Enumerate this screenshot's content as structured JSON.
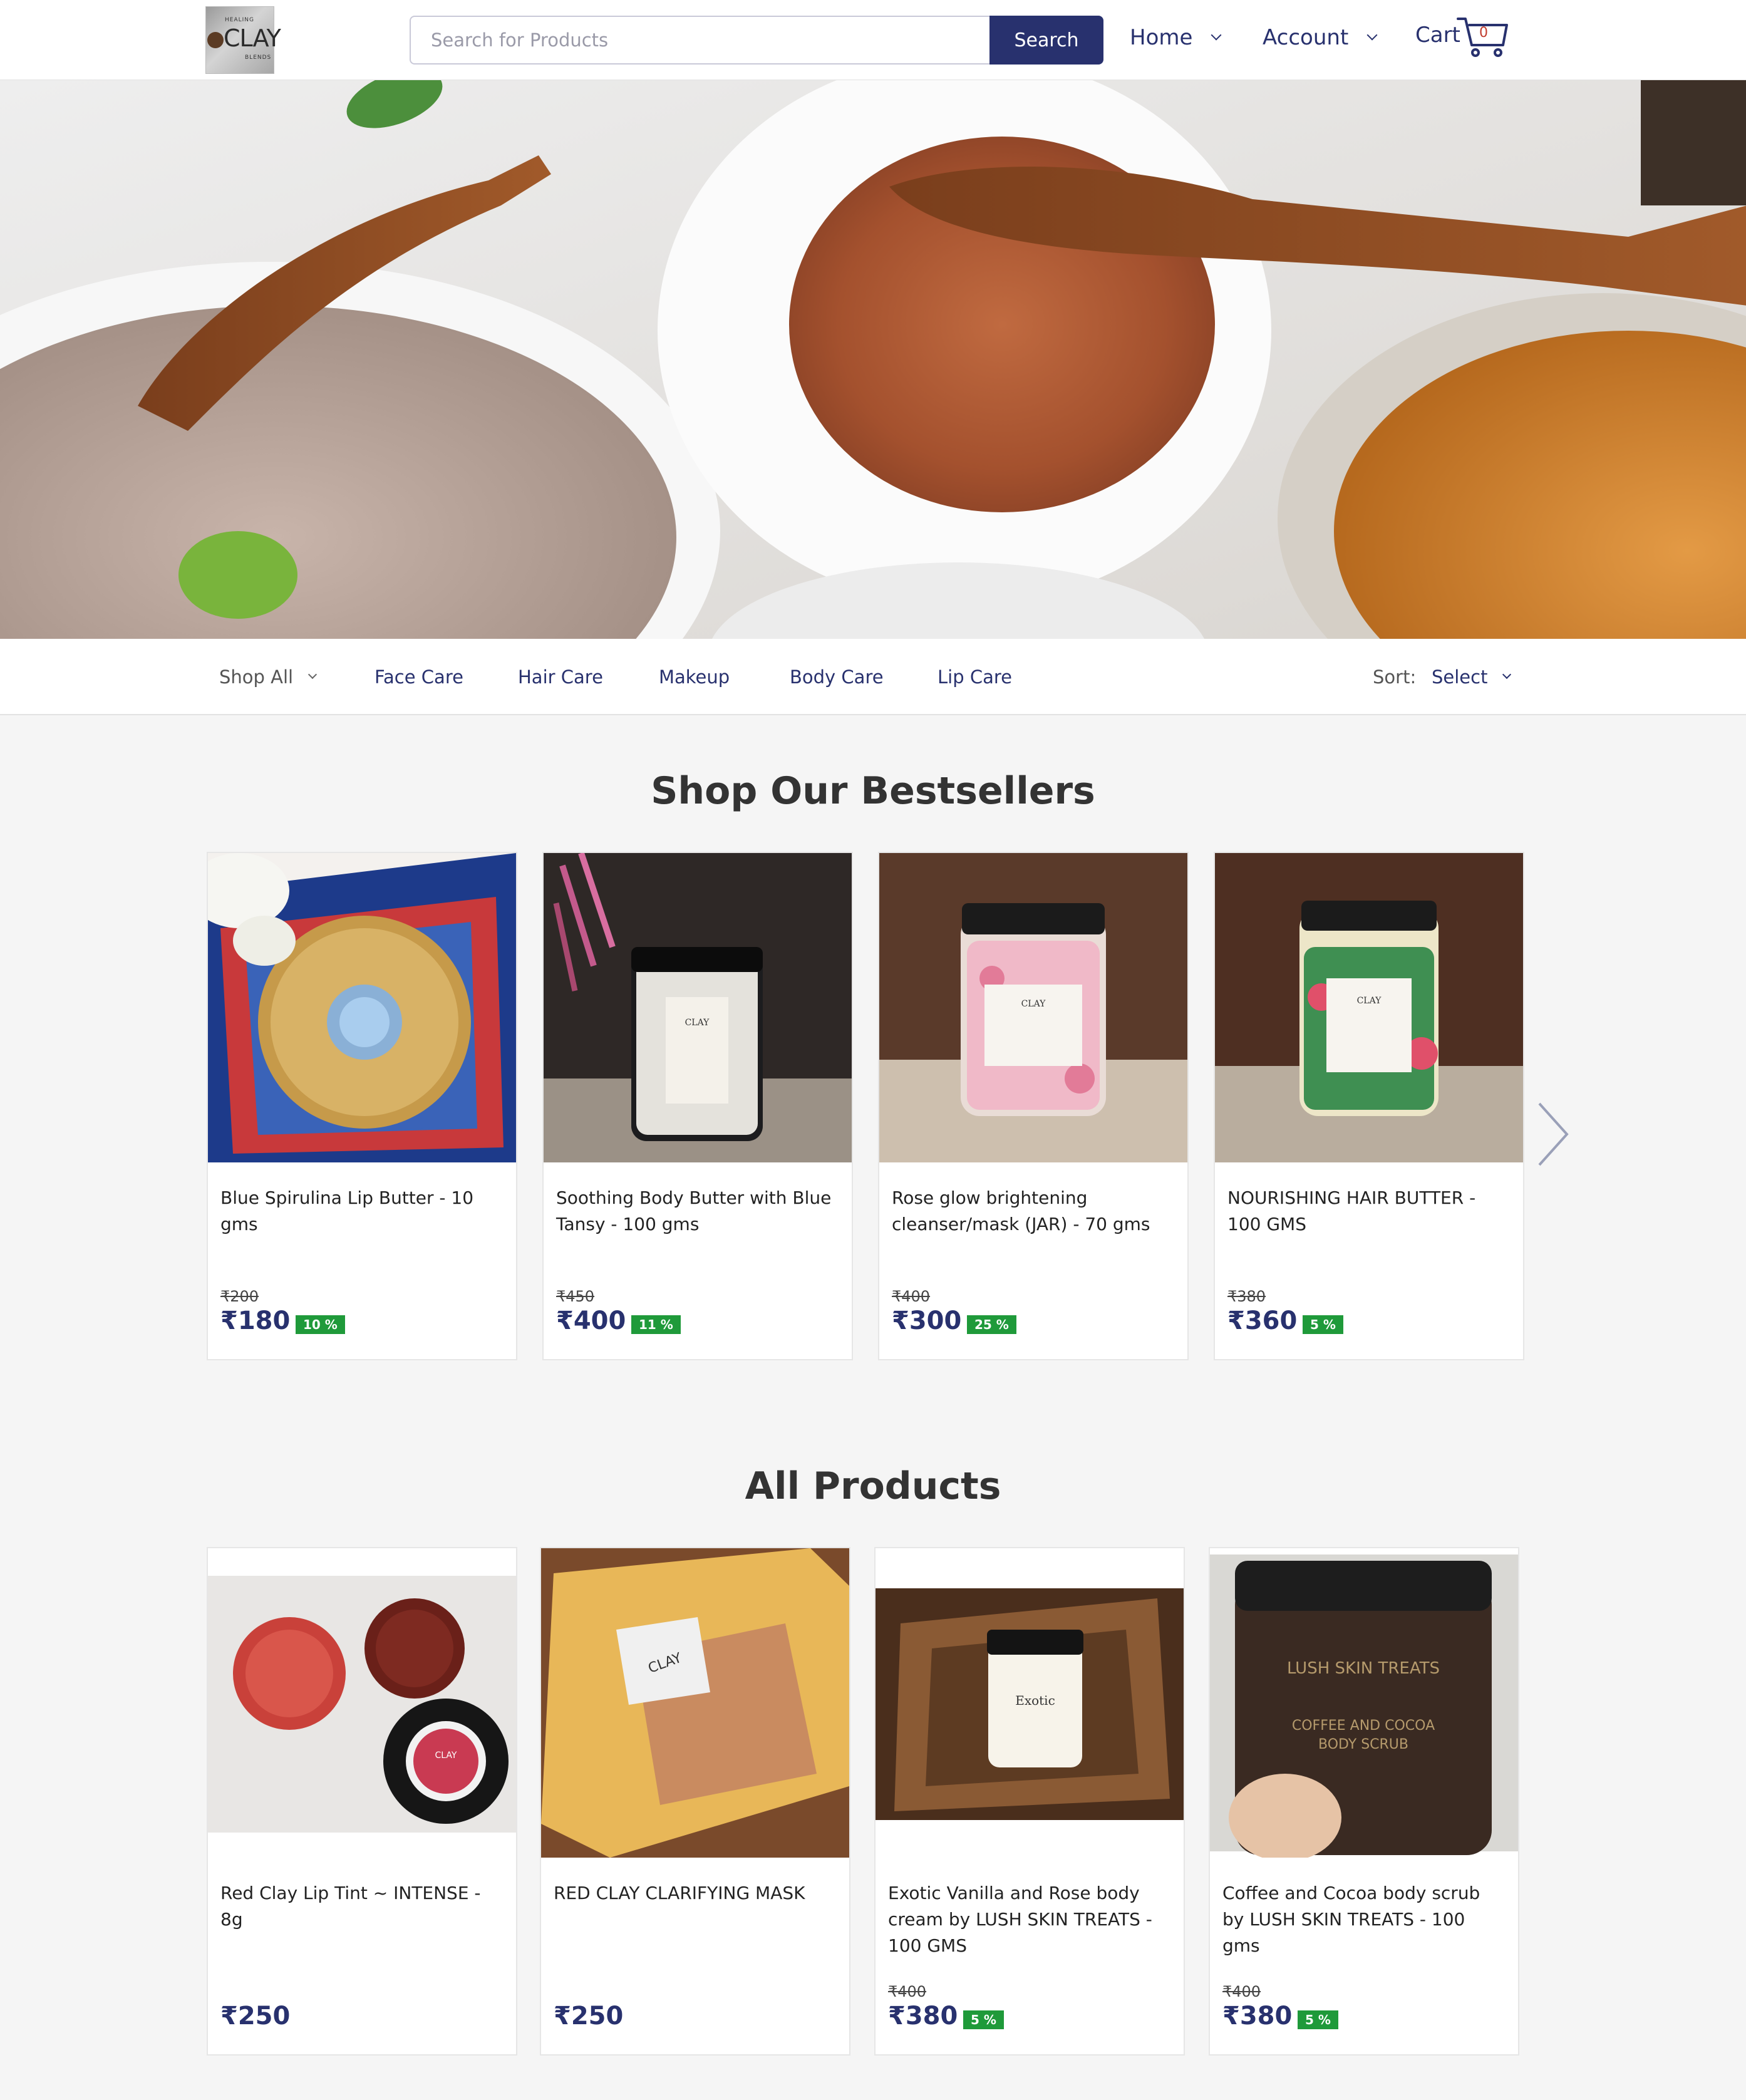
{
  "header": {
    "logo": {
      "top": "HEALING",
      "word": "CLAY",
      "bottom": "BLENDS"
    },
    "search_placeholder": "Search for Products",
    "search_button": "Search",
    "nav": [
      {
        "label": "Home",
        "icon": "chevron-down-icon"
      },
      {
        "label": "Account",
        "icon": "chevron-down-icon"
      }
    ],
    "cart": {
      "label": "Cart",
      "count": "0",
      "icon": "shopping-cart-icon"
    }
  },
  "categories": {
    "items": [
      "Shop All",
      "Face Care",
      "Hair Care",
      "Makeup",
      "Body Care",
      "Lip Care"
    ],
    "sort_label": "Sort:",
    "sort_value": "Select"
  },
  "bestsellers": {
    "title": "Shop Our Bestsellers",
    "products": [
      {
        "name": "Blue Spirulina Lip Butter - 10 gms",
        "old_price": "₹200",
        "price": "₹180",
        "discount": "10 %"
      },
      {
        "name": "Soothing Body Butter with Blue Tansy - 100 gms",
        "old_price": "₹450",
        "price": "₹400",
        "discount": "11 %"
      },
      {
        "name": "Rose glow brightening cleanser/mask (JAR) - 70 gms",
        "old_price": "₹400",
        "price": "₹300",
        "discount": "25 %"
      },
      {
        "name": "NOURISHING HAIR BUTTER - 100 GMS",
        "old_price": "₹380",
        "price": "₹360",
        "discount": "5 %"
      }
    ],
    "next_icon": "chevron-right-icon"
  },
  "all_products": {
    "title": "All Products",
    "products": [
      {
        "name": "Red Clay Lip Tint ~ INTENSE - 8g",
        "old_price": "",
        "price": "₹250",
        "discount": ""
      },
      {
        "name": "RED CLAY CLARIFYING MASK",
        "old_price": "",
        "price": "₹250",
        "discount": ""
      },
      {
        "name": "Exotic Vanilla and Rose body cream by LUSH SKIN TREATS - 100 GMS",
        "old_price": "₹400",
        "price": "₹380",
        "discount": "5 %"
      },
      {
        "name": "Coffee and Cocoa body scrub by LUSH SKIN TREATS - 100 gms",
        "old_price": "₹400",
        "price": "₹380",
        "discount": "5 %"
      }
    ]
  },
  "colors": {
    "brand": "#28316e",
    "discount": "#1f9a3a",
    "background": "#f5f5f5"
  }
}
